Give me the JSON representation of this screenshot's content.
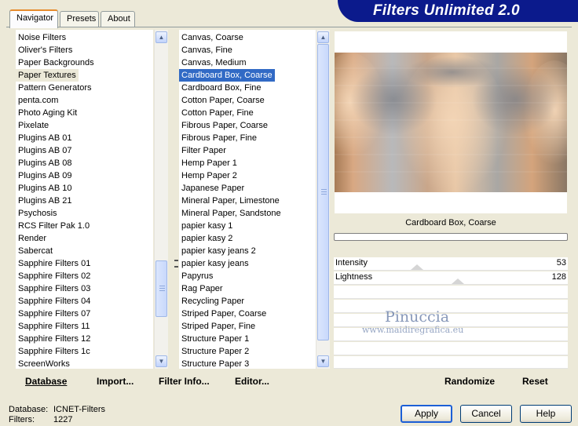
{
  "app": {
    "title": "Filters Unlimited 2.0",
    "accent_color": "#0b1a8c"
  },
  "tabs": [
    {
      "label": "Navigator",
      "active": true
    },
    {
      "label": "Presets",
      "active": false
    },
    {
      "label": "About",
      "active": false
    }
  ],
  "categories": {
    "selected": "Paper Textures",
    "items": [
      "Noise Filters",
      "Oliver's Filters",
      "Paper Backgrounds",
      "Paper Textures",
      "Pattern Generators",
      "penta.com",
      "Photo Aging Kit",
      "Pixelate",
      "Plugins AB 01",
      "Plugins AB 07",
      "Plugins AB 08",
      "Plugins AB 09",
      "Plugins AB 10",
      "Plugins AB 21",
      "Psychosis",
      "RCS Filter Pak 1.0",
      "Render",
      "Sabercat",
      "Sapphire Filters 01",
      "Sapphire Filters 02",
      "Sapphire Filters 03",
      "Sapphire Filters 04",
      "Sapphire Filters 07",
      "Sapphire Filters 11",
      "Sapphire Filters 12",
      "Sapphire Filters 1c",
      "ScreenWorks"
    ]
  },
  "filters": {
    "selected": "Cardboard Box, Coarse",
    "items": [
      "Canvas, Coarse",
      "Canvas, Fine",
      "Canvas, Medium",
      "Cardboard Box, Coarse",
      "Cardboard Box, Fine",
      "Cotton Paper, Coarse",
      "Cotton Paper, Fine",
      "Fibrous Paper, Coarse",
      "Fibrous Paper, Fine",
      "Filter Paper",
      "Hemp Paper 1",
      "Hemp Paper 2",
      "Japanese Paper",
      "Mineral Paper, Limestone",
      "Mineral Paper, Sandstone",
      "papier kasy 1",
      "papier kasy 2",
      "papier kasy jeans 2",
      "papier kasy jeans",
      "Papyrus",
      "Rag Paper",
      "Recycling Paper",
      "Striped Paper, Coarse",
      "Striped Paper, Fine",
      "Structure Paper 1",
      "Structure Paper 2",
      "Structure Paper 3"
    ]
  },
  "toolbar": {
    "database": "Database",
    "import": "Import...",
    "filter_info": "Filter Info...",
    "editor": "Editor..."
  },
  "preview": {
    "filter_name": "Cardboard Box, Coarse",
    "params": [
      {
        "label": "Intensity",
        "value": "53",
        "fraction": 0.21
      },
      {
        "label": "Lightness",
        "value": "128",
        "fraction": 0.5
      }
    ],
    "watermark": "Pinuccia",
    "watermark_url": "www.maidiregrafica.eu"
  },
  "right_buttons": {
    "randomize": "Randomize",
    "reset": "Reset"
  },
  "status": {
    "database_label": "Database:",
    "database_value": "ICNET-Filters",
    "filters_label": "Filters:",
    "filters_value": "1227"
  },
  "dialog_buttons": {
    "apply": "Apply",
    "cancel": "Cancel",
    "help": "Help"
  },
  "icons": {
    "scroll_up": "▲",
    "scroll_down": "▼"
  }
}
